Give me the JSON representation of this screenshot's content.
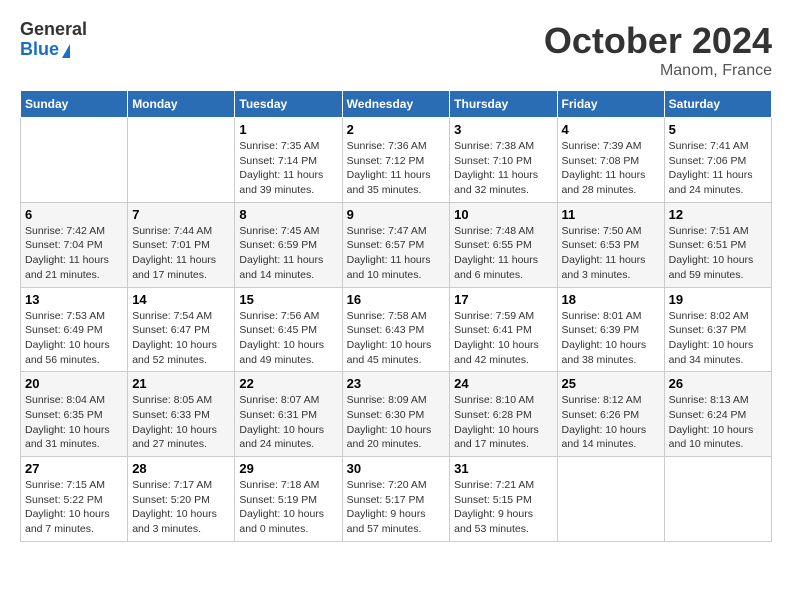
{
  "header": {
    "logo_general": "General",
    "logo_blue": "Blue",
    "month": "October 2024",
    "location": "Manom, France"
  },
  "weekdays": [
    "Sunday",
    "Monday",
    "Tuesday",
    "Wednesday",
    "Thursday",
    "Friday",
    "Saturday"
  ],
  "weeks": [
    [
      {
        "day": "",
        "sunrise": "",
        "sunset": "",
        "daylight": ""
      },
      {
        "day": "",
        "sunrise": "",
        "sunset": "",
        "daylight": ""
      },
      {
        "day": "1",
        "sunrise": "Sunrise: 7:35 AM",
        "sunset": "Sunset: 7:14 PM",
        "daylight": "Daylight: 11 hours and 39 minutes."
      },
      {
        "day": "2",
        "sunrise": "Sunrise: 7:36 AM",
        "sunset": "Sunset: 7:12 PM",
        "daylight": "Daylight: 11 hours and 35 minutes."
      },
      {
        "day": "3",
        "sunrise": "Sunrise: 7:38 AM",
        "sunset": "Sunset: 7:10 PM",
        "daylight": "Daylight: 11 hours and 32 minutes."
      },
      {
        "day": "4",
        "sunrise": "Sunrise: 7:39 AM",
        "sunset": "Sunset: 7:08 PM",
        "daylight": "Daylight: 11 hours and 28 minutes."
      },
      {
        "day": "5",
        "sunrise": "Sunrise: 7:41 AM",
        "sunset": "Sunset: 7:06 PM",
        "daylight": "Daylight: 11 hours and 24 minutes."
      }
    ],
    [
      {
        "day": "6",
        "sunrise": "Sunrise: 7:42 AM",
        "sunset": "Sunset: 7:04 PM",
        "daylight": "Daylight: 11 hours and 21 minutes."
      },
      {
        "day": "7",
        "sunrise": "Sunrise: 7:44 AM",
        "sunset": "Sunset: 7:01 PM",
        "daylight": "Daylight: 11 hours and 17 minutes."
      },
      {
        "day": "8",
        "sunrise": "Sunrise: 7:45 AM",
        "sunset": "Sunset: 6:59 PM",
        "daylight": "Daylight: 11 hours and 14 minutes."
      },
      {
        "day": "9",
        "sunrise": "Sunrise: 7:47 AM",
        "sunset": "Sunset: 6:57 PM",
        "daylight": "Daylight: 11 hours and 10 minutes."
      },
      {
        "day": "10",
        "sunrise": "Sunrise: 7:48 AM",
        "sunset": "Sunset: 6:55 PM",
        "daylight": "Daylight: 11 hours and 6 minutes."
      },
      {
        "day": "11",
        "sunrise": "Sunrise: 7:50 AM",
        "sunset": "Sunset: 6:53 PM",
        "daylight": "Daylight: 11 hours and 3 minutes."
      },
      {
        "day": "12",
        "sunrise": "Sunrise: 7:51 AM",
        "sunset": "Sunset: 6:51 PM",
        "daylight": "Daylight: 10 hours and 59 minutes."
      }
    ],
    [
      {
        "day": "13",
        "sunrise": "Sunrise: 7:53 AM",
        "sunset": "Sunset: 6:49 PM",
        "daylight": "Daylight: 10 hours and 56 minutes."
      },
      {
        "day": "14",
        "sunrise": "Sunrise: 7:54 AM",
        "sunset": "Sunset: 6:47 PM",
        "daylight": "Daylight: 10 hours and 52 minutes."
      },
      {
        "day": "15",
        "sunrise": "Sunrise: 7:56 AM",
        "sunset": "Sunset: 6:45 PM",
        "daylight": "Daylight: 10 hours and 49 minutes."
      },
      {
        "day": "16",
        "sunrise": "Sunrise: 7:58 AM",
        "sunset": "Sunset: 6:43 PM",
        "daylight": "Daylight: 10 hours and 45 minutes."
      },
      {
        "day": "17",
        "sunrise": "Sunrise: 7:59 AM",
        "sunset": "Sunset: 6:41 PM",
        "daylight": "Daylight: 10 hours and 42 minutes."
      },
      {
        "day": "18",
        "sunrise": "Sunrise: 8:01 AM",
        "sunset": "Sunset: 6:39 PM",
        "daylight": "Daylight: 10 hours and 38 minutes."
      },
      {
        "day": "19",
        "sunrise": "Sunrise: 8:02 AM",
        "sunset": "Sunset: 6:37 PM",
        "daylight": "Daylight: 10 hours and 34 minutes."
      }
    ],
    [
      {
        "day": "20",
        "sunrise": "Sunrise: 8:04 AM",
        "sunset": "Sunset: 6:35 PM",
        "daylight": "Daylight: 10 hours and 31 minutes."
      },
      {
        "day": "21",
        "sunrise": "Sunrise: 8:05 AM",
        "sunset": "Sunset: 6:33 PM",
        "daylight": "Daylight: 10 hours and 27 minutes."
      },
      {
        "day": "22",
        "sunrise": "Sunrise: 8:07 AM",
        "sunset": "Sunset: 6:31 PM",
        "daylight": "Daylight: 10 hours and 24 minutes."
      },
      {
        "day": "23",
        "sunrise": "Sunrise: 8:09 AM",
        "sunset": "Sunset: 6:30 PM",
        "daylight": "Daylight: 10 hours and 20 minutes."
      },
      {
        "day": "24",
        "sunrise": "Sunrise: 8:10 AM",
        "sunset": "Sunset: 6:28 PM",
        "daylight": "Daylight: 10 hours and 17 minutes."
      },
      {
        "day": "25",
        "sunrise": "Sunrise: 8:12 AM",
        "sunset": "Sunset: 6:26 PM",
        "daylight": "Daylight: 10 hours and 14 minutes."
      },
      {
        "day": "26",
        "sunrise": "Sunrise: 8:13 AM",
        "sunset": "Sunset: 6:24 PM",
        "daylight": "Daylight: 10 hours and 10 minutes."
      }
    ],
    [
      {
        "day": "27",
        "sunrise": "Sunrise: 7:15 AM",
        "sunset": "Sunset: 5:22 PM",
        "daylight": "Daylight: 10 hours and 7 minutes."
      },
      {
        "day": "28",
        "sunrise": "Sunrise: 7:17 AM",
        "sunset": "Sunset: 5:20 PM",
        "daylight": "Daylight: 10 hours and 3 minutes."
      },
      {
        "day": "29",
        "sunrise": "Sunrise: 7:18 AM",
        "sunset": "Sunset: 5:19 PM",
        "daylight": "Daylight: 10 hours and 0 minutes."
      },
      {
        "day": "30",
        "sunrise": "Sunrise: 7:20 AM",
        "sunset": "Sunset: 5:17 PM",
        "daylight": "Daylight: 9 hours and 57 minutes."
      },
      {
        "day": "31",
        "sunrise": "Sunrise: 7:21 AM",
        "sunset": "Sunset: 5:15 PM",
        "daylight": "Daylight: 9 hours and 53 minutes."
      },
      {
        "day": "",
        "sunrise": "",
        "sunset": "",
        "daylight": ""
      },
      {
        "day": "",
        "sunrise": "",
        "sunset": "",
        "daylight": ""
      }
    ]
  ]
}
